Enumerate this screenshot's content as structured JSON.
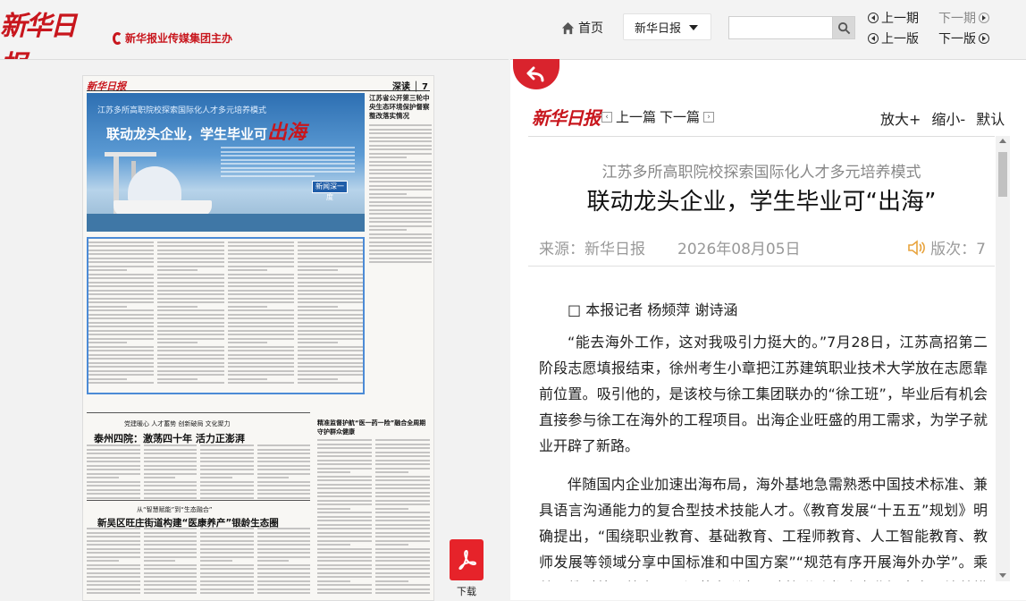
{
  "header": {
    "brand": "新华日报",
    "brand_sub": "新华报业传媒集团主办",
    "home_label": "首页",
    "paper_select": "新华日报",
    "search_placeholder": "",
    "prev_issue": "上一期",
    "next_issue": "下一期",
    "prev_page": "上一版",
    "next_page": "下一版"
  },
  "newspaper_page": {
    "masthead": "新华日报",
    "section": "深读 │ 7",
    "hero_kicker": "江苏多所高职院校探索国际化人才多元培养模式",
    "hero_title": "联动龙头企业，学生毕业可",
    "hero_title_accent": "出海",
    "hero_badge": "新闻深一度",
    "side_title": "江苏省公开第三轮中央生态环境保护督察整改落实情况",
    "lower_kicker_1": "党建暖心 人才蓄势 创新破局 文化聚力",
    "lower_headline_1": "泰州四院：激荡四十年 活力正澎湃",
    "lower_kicker_2": "从“智慧赋能”到“生态融合”",
    "lower_headline_2": "新吴区旺庄街道构建“医康养产”银龄生态圈",
    "lower_headline_3": "精准监督护航“医一药一险”融合全周期守护群众健康"
  },
  "download": {
    "label": "下载",
    "icon": "pdf-icon"
  },
  "reader": {
    "masthead": "新华日报",
    "prev_article": "上一篇",
    "next_article": "下一篇",
    "zoom_in": "放大+",
    "zoom_out": "缩小-",
    "zoom_default": "默认"
  },
  "article": {
    "kicker": "江苏多所高职院校探索国际化人才多元培养模式",
    "title": "联动龙头企业，学生毕业可“出海”",
    "source": "来源：新华日报",
    "date": "2026年08月05日",
    "edition": "版次：7",
    "byline": "□ 本报记者 杨频萍 谢诗涵",
    "paragraphs": [
      "“能去海外工作，这对我吸引力挺大的。”7月28日，江苏高招第二阶段志愿填报结束，徐州考生小章把江苏建筑职业技术大学放在志愿靠前位置。吸引他的，是该校与徐工集团联办的“徐工班”，毕业后有机会直接参与徐工在海外的工程项目。出海企业旺盛的用工需求，为学子就业开辟了新路。",
      "伴随国内企业加速出海布局，海外基地急需熟悉中国技术标准、兼具语言沟通能力的复合型技术技能人才。《教育发展“十五五”规划》明确提出，“围绕职业教育、基础教育、工程师教育、人工智能教育、教师发展等领域分享中国标准和中国方案”“规范有序开展海外办学”。乘着职教对外开放窗口，江苏多所高职院校联动龙头企业探索多元培养模式。"
    ]
  },
  "colors": {
    "brand_red": "#c8161d",
    "pdf_red": "#e6232a",
    "accent_blue": "#4c8bd6",
    "speaker_orange": "#e8a33d"
  }
}
